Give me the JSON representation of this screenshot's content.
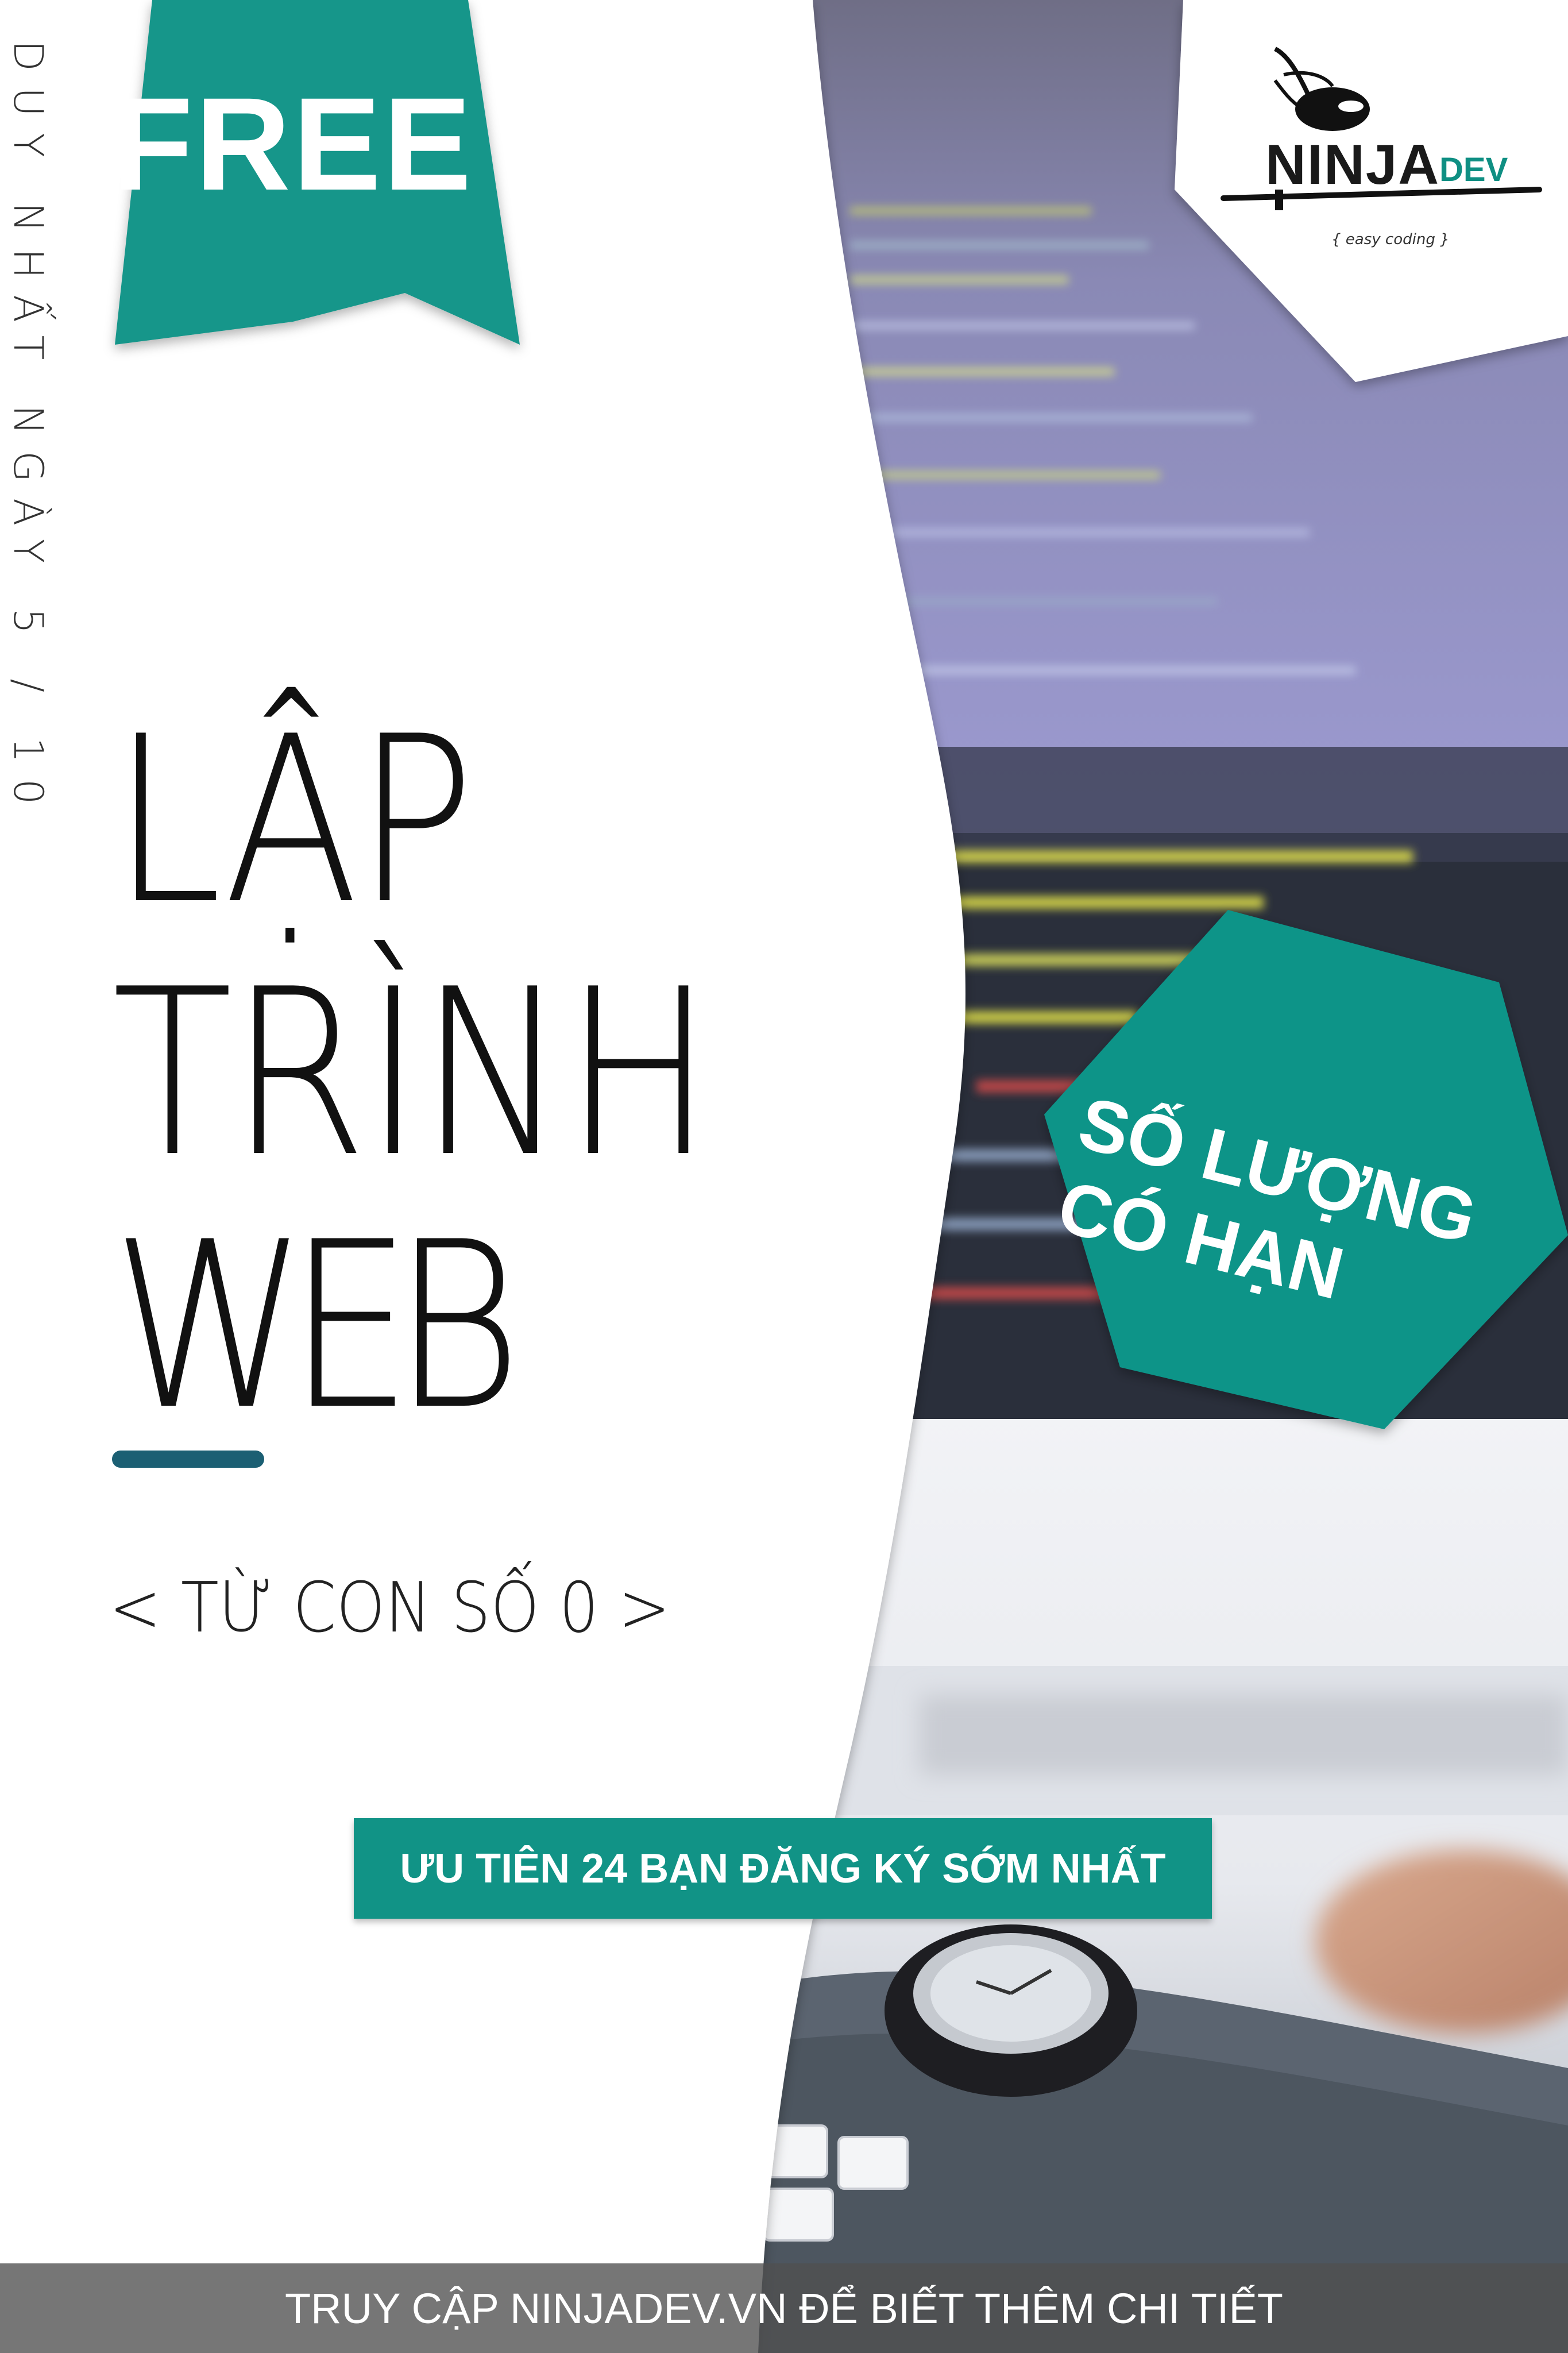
{
  "side_text": "DUY NHẤT NGÀY 5 / 10",
  "badge": {
    "label": "FREE"
  },
  "logo": {
    "word": "NINJA",
    "suffix": "DEV",
    "tagline": "{ easy coding }"
  },
  "title": {
    "line1": "LẬP",
    "line2": "TRÌNH",
    "line3": "WEB"
  },
  "subtitle": "< TỪ CON SỐ 0 >",
  "hexagon": {
    "line1": "SỐ LƯỢNG",
    "line2": "CÓ HẠN"
  },
  "cta": {
    "label": "ƯU TIÊN 24 BẠN ĐĂNG KÝ SỚM NHẤT"
  },
  "footer": {
    "text": "TRUY CẬP NINJADEV.VN ĐỂ BIẾT THÊM CHI TIẾT"
  },
  "colors": {
    "accent": "#119386",
    "bar": "#1b5f73",
    "text": "#111111",
    "footer_bg": "#505050"
  }
}
